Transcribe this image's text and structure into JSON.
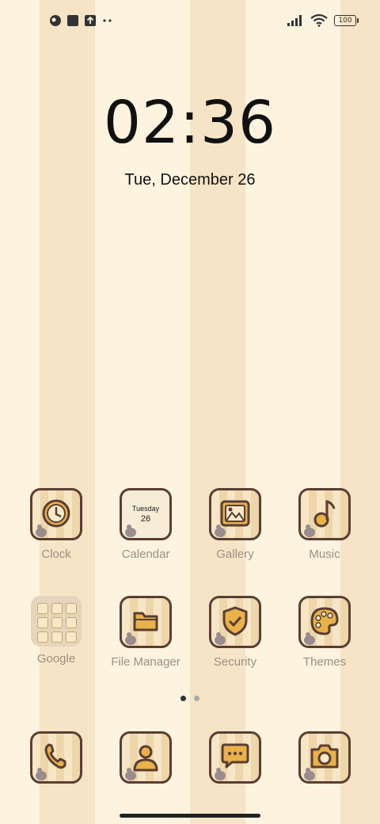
{
  "status_bar": {
    "left_icons": [
      "notification-app-icon",
      "square-notification-icon",
      "upload-icon",
      "more-dots-icon"
    ],
    "right_icons": [
      "signal-icon",
      "wifi-icon",
      "battery-icon"
    ],
    "battery": "100"
  },
  "lockscreen": {
    "time": "02:36",
    "date": "Tue, December 26"
  },
  "apps_row1": [
    {
      "label": "Clock",
      "icon": "clock-icon"
    },
    {
      "label": "Calendar",
      "icon": "calendar-icon",
      "day": "Tuesday",
      "date": "26"
    },
    {
      "label": "Gallery",
      "icon": "gallery-icon"
    },
    {
      "label": "Music",
      "icon": "music-icon"
    }
  ],
  "apps_row2": [
    {
      "label": "Google",
      "icon": "google-folder-icon"
    },
    {
      "label": "File Manager",
      "icon": "folder-icon"
    },
    {
      "label": "Security",
      "icon": "shield-icon"
    },
    {
      "label": "Themes",
      "icon": "palette-icon"
    }
  ],
  "dock": [
    {
      "icon": "phone-icon"
    },
    {
      "icon": "contacts-icon"
    },
    {
      "icon": "messages-icon"
    },
    {
      "icon": "camera-icon"
    }
  ],
  "page_indicator": {
    "pages": 2,
    "current": 1
  },
  "colors": {
    "accent": "#e8b14a",
    "outline": "#5a3e33",
    "label": "#9a9085"
  }
}
